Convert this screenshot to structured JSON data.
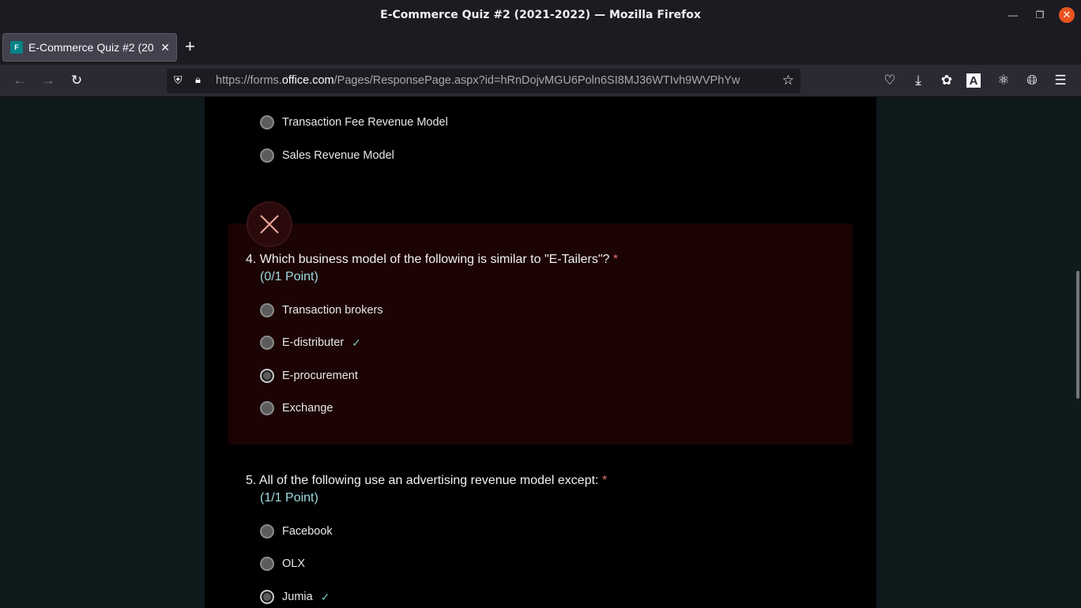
{
  "window": {
    "title": "E-Commerce Quiz #2 (2021-2022) — Mozilla Firefox"
  },
  "tab": {
    "label": "E-Commerce Quiz #2 (2021-2022)",
    "favicon": "F"
  },
  "urlbar": {
    "prefix": "https://forms.",
    "domain": "office.com",
    "path": "/Pages/ResponsePage.aspx?id=hRnDojvMGU6Poln6SI8MJ36WTIvh9WVPhYw"
  },
  "quiz": {
    "q3_choices": [
      {
        "label": "Transaction Fee Revenue Model"
      },
      {
        "label": "Sales Revenue Model"
      }
    ],
    "q4": {
      "number": "4.",
      "text": "Which business model of the following is similar to \"E-Tailers\"?",
      "required_mark": "*",
      "points": "(0/1 Point)",
      "choices": [
        {
          "label": "Transaction brokers"
        },
        {
          "label": "E-distributer"
        },
        {
          "label": "E-procurement"
        },
        {
          "label": "Exchange"
        }
      ]
    },
    "q5": {
      "number": "5.",
      "text": "All of the following use an advertising revenue model except:",
      "required_mark": "*",
      "points": "(1/1 Point)",
      "choices": [
        {
          "label": "Facebook"
        },
        {
          "label": "OLX"
        },
        {
          "label": "Jumia"
        }
      ]
    }
  },
  "colors": {
    "wrong_bg": "#1c0304",
    "points_color": "#9fdbe0",
    "correct_check": "#6fc7b8",
    "required": "#e0736a"
  }
}
